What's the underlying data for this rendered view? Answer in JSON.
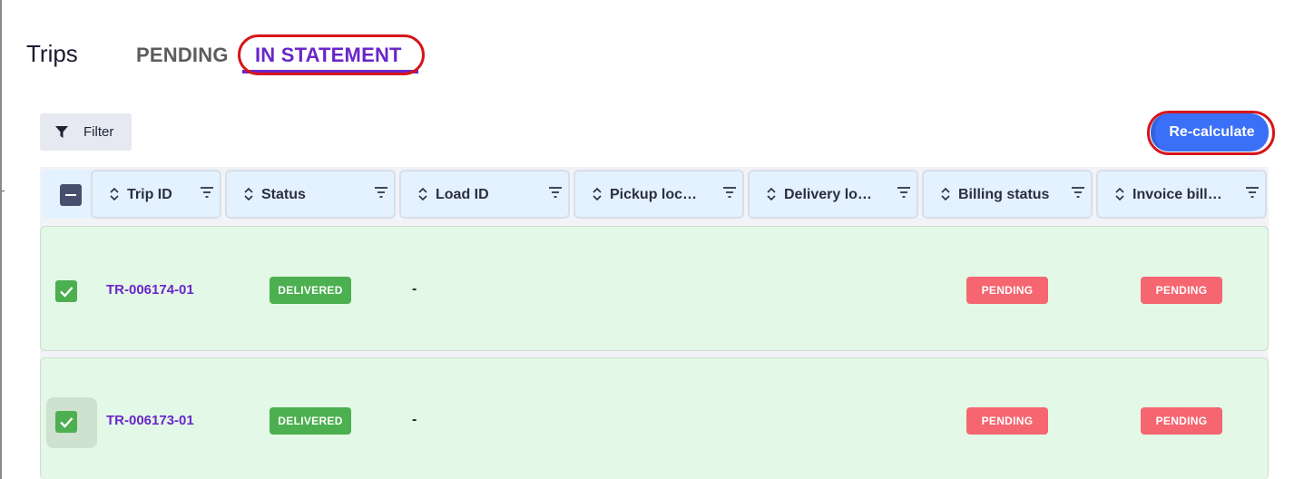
{
  "page": {
    "title": "Trips"
  },
  "tabs": [
    {
      "label": "PENDING",
      "active": false
    },
    {
      "label": "IN STATEMENT",
      "active": true
    }
  ],
  "toolbar": {
    "filter_label": "Filter",
    "recalculate_label": "Re-calculate"
  },
  "colors": {
    "accent_purple": "#6a26c9",
    "primary_blue": "#3a6ff7",
    "delivered_green": "#4caf50",
    "pending_red": "#f56670",
    "row_selected_bg": "#e3f8e6",
    "highlight_red": "#d5161b"
  },
  "table": {
    "columns": [
      {
        "label": "Trip ID"
      },
      {
        "label": "Status"
      },
      {
        "label": "Load ID"
      },
      {
        "label": "Pickup loc…"
      },
      {
        "label": "Delivery lo…"
      },
      {
        "label": "Billing status"
      },
      {
        "label": "Invoice bill…"
      }
    ],
    "header_checkbox_state": "indeterminate",
    "rows": [
      {
        "selected": true,
        "trip_id": "TR-006174-01",
        "status": "DELIVERED",
        "load_id": "-",
        "pickup_location": "",
        "delivery_location": "",
        "billing_status": "PENDING",
        "invoice_billing": "PENDING"
      },
      {
        "selected": true,
        "trip_id": "TR-006173-01",
        "status": "DELIVERED",
        "load_id": "-",
        "pickup_location": "",
        "delivery_location": "",
        "billing_status": "PENDING",
        "invoice_billing": "PENDING"
      }
    ]
  },
  "icons": {
    "filter": "filter-icon",
    "sort": "sort-icon",
    "column_menu": "column-menu-icon",
    "check": "check-icon"
  }
}
